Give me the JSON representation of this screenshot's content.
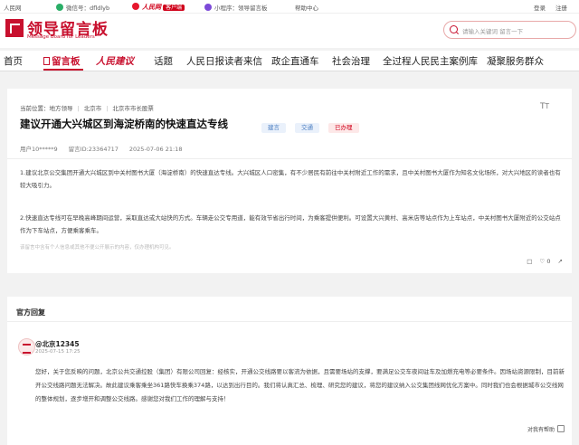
{
  "topbar": {
    "site": "人民网",
    "wechat": "微信号：dfldlyb",
    "rm_brand": "人民网",
    "client": "客户端",
    "mini": "小程序：领导留言板",
    "help": "帮助中心",
    "login": "登录",
    "register": "注册"
  },
  "header": {
    "logo_title": "领导留言板",
    "logo_sub": "Message Board for Leaders",
    "search_placeholder": "请输入关键词 留言一下"
  },
  "nav": {
    "items": [
      "首页",
      "留言板",
      "人民建议",
      "话题",
      "人民日报读者来信",
      "政企直通车",
      "社会治理",
      "全过程人民民主案例库",
      "凝聚服务群众"
    ]
  },
  "message": {
    "crumb_label": "当前位置：",
    "crumbs": [
      "地方领导",
      "北京市",
      "北京市市长股票"
    ],
    "title": "建议开通大兴城区到海淀桥南的快速直达专线",
    "tags": [
      "建言",
      "交通",
      "已办理"
    ],
    "user": "用户10*****9",
    "msg_id": "留言ID:23364717",
    "date": "2025-07-06 21:18",
    "paragraph1": "1.建议北京公交集团开通大兴城区到中关村图书大厦（海淀桥南）的快速直达专线。大兴城区人口密集，有不少居民有前往中关村附近工作的需求，且中关村图书大厦作为知名文化场所，对大兴地区的读者也有较大吸引力。",
    "paragraph2": "2.快速直达专线可在早晚高峰期间运营，采取直达或大站快的方式。车辆走公交专用道，能有效节省出行时间，为乘客提供便利。可设置大兴黄村、高米店等站点作为上车站点，中关村图书大厦附近的公交站点作为下车站点，方便乘客乘车。",
    "note": "该留言中含有个人信息或其他不便公开展示的内容，仅办理机构可见。",
    "likes": "0"
  },
  "reply": {
    "section_title": "官方回复",
    "responder": "@北京12345",
    "time": "2025-07-15 17:25",
    "text": "您好，关于您反映的问题，北京公共交通控股（集团）有限公司回复：经核实，开通公交线路要以客流为依据，且需要场站的支撑，要满足公交车夜间驻车及加燃充电等必要条件。因场站资源限制，目前新开公交线路问题无法解决。故此建议乘客乘坐361路快车换乘374路，以达到出行目的。我们将认真汇总、梳理、研究您的建议，将您的建议纳入公交集团线网优化方案中。同时我们也会根据城市公交线网的整体规划，逐步增开和调整公交线路。感谢您对我们工作的理解与支持！",
    "helpful": "对我有帮助"
  }
}
